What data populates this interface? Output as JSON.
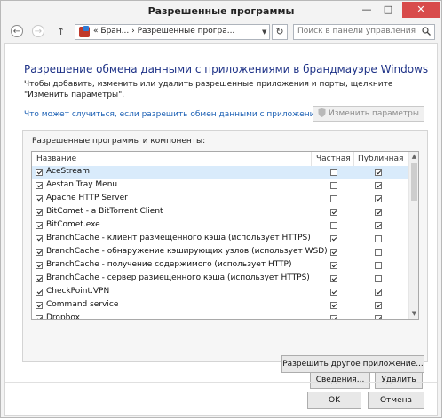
{
  "window": {
    "title": "Разрешенные программы"
  },
  "nav": {
    "breadcrumb_sep": "«",
    "crumb1": "Бран...",
    "crumb_arrow": "›",
    "crumb2": "Разрешенные програ...",
    "search_placeholder": "Поиск в панели управления"
  },
  "main": {
    "heading": "Разрешение обмена данными с приложениями в брандмауэре Windows",
    "description": "Чтобы добавить, изменить или удалить разрешенные приложения и порты, щелкните \"Изменить параметры\".",
    "risk_link": "Что может случиться, если разрешить обмен данными с приложением?",
    "change_settings": "Изменить параметры"
  },
  "apps": {
    "group_label": "Разрешенные программы и компоненты:",
    "columns": {
      "name": "Название",
      "private": "Частная",
      "public": "Публичная"
    },
    "rows": [
      {
        "name": "AceStream",
        "enabled": true,
        "private": false,
        "public": true,
        "selected": true
      },
      {
        "name": "Aestan Tray Menu",
        "enabled": true,
        "private": false,
        "public": true
      },
      {
        "name": "Apache HTTP Server",
        "enabled": true,
        "private": false,
        "public": true
      },
      {
        "name": "BitComet - a BitTorrent Client",
        "enabled": true,
        "private": true,
        "public": true
      },
      {
        "name": "BitComet.exe",
        "enabled": true,
        "private": false,
        "public": true
      },
      {
        "name": "BranchCache - клиент размещенного кэша (использует HTTPS)",
        "enabled": true,
        "private": true,
        "public": false
      },
      {
        "name": "BranchCache - обнаружение кэширующих узлов (использует WSD)",
        "enabled": true,
        "private": true,
        "public": false
      },
      {
        "name": "BranchCache - получение содержимого (использует HTTP)",
        "enabled": true,
        "private": true,
        "public": false
      },
      {
        "name": "BranchCache - сервер размещенного кэша (использует HTTPS)",
        "enabled": true,
        "private": true,
        "public": false
      },
      {
        "name": "CheckPoint.VPN",
        "enabled": true,
        "private": true,
        "public": true
      },
      {
        "name": "Command service",
        "enabled": true,
        "private": true,
        "public": true
      },
      {
        "name": "Dropbox",
        "enabled": true,
        "private": true,
        "public": true
      }
    ],
    "details_button": "Сведения...",
    "delete_button": "Удалить",
    "allow_another_button": "Разрешить другое приложение..."
  },
  "footer": {
    "ok": "OK",
    "cancel": "Отмена"
  },
  "colors": {
    "heading": "#1e3287",
    "link": "#1a5fb4",
    "close_button": "#d84b4b",
    "selected_row": "#d9ebfb"
  }
}
